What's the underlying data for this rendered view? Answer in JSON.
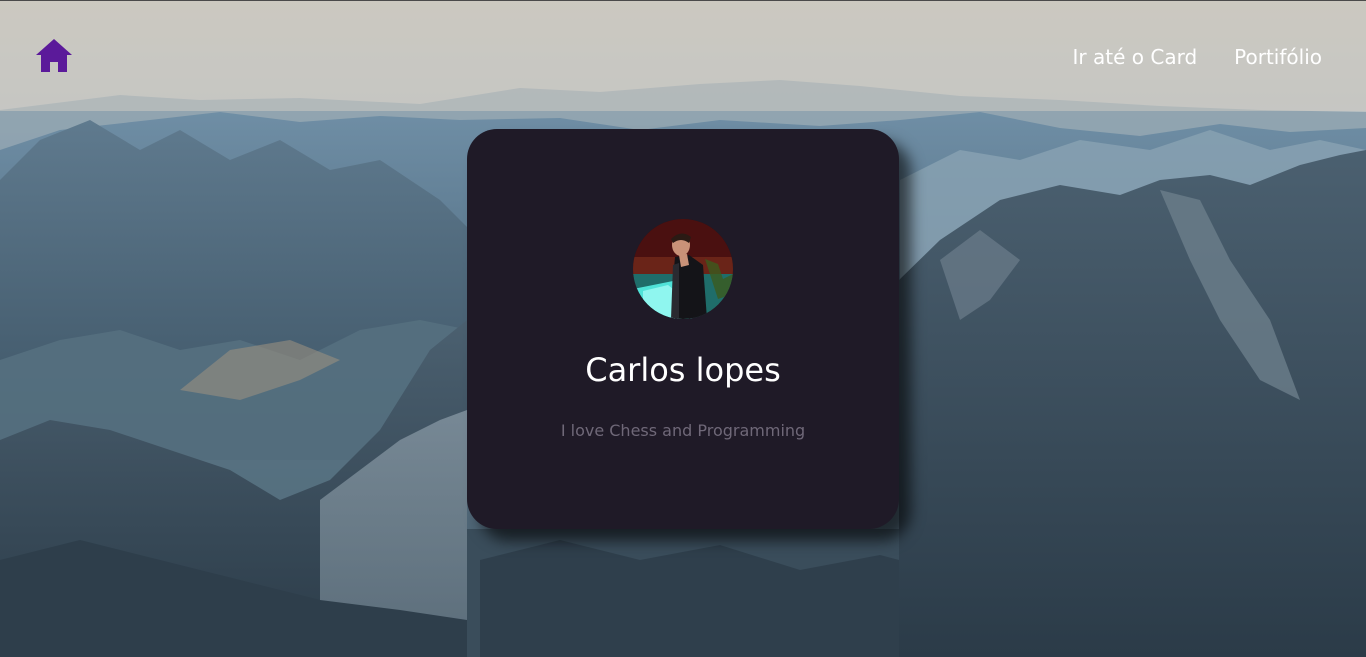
{
  "nav": {
    "home_icon": "home-icon",
    "home_color": "#5b1a9a",
    "links": [
      {
        "label": "Ir até o Card"
      },
      {
        "label": "Portifólio"
      }
    ]
  },
  "card": {
    "name": "Carlos lopes",
    "bio": "I love Chess and Programming",
    "background": "#1f1a27"
  },
  "background": {
    "image": "mountain-landscape"
  }
}
